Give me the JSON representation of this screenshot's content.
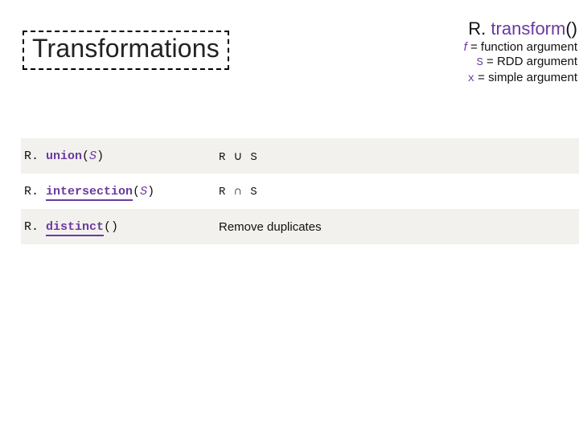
{
  "title": "Transformations",
  "legend": {
    "hdr_prefix": "R. ",
    "hdr_method": "transform",
    "hdr_suffix": "()",
    "rows": [
      {
        "sym": "f",
        "rest": " = function argument"
      },
      {
        "code": "S",
        "rest": " = RDD argument"
      },
      {
        "code": "x",
        "rest": " = simple argument"
      }
    ]
  },
  "rows": [
    {
      "call_prefix": "R. ",
      "method": "union",
      "method_underline": false,
      "call_open": "(",
      "arg": "S",
      "call_close": ")",
      "desc_code_a": "R",
      "desc_sym": "∪",
      "desc_code_b": "S",
      "desc_plain": null
    },
    {
      "call_prefix": "R. ",
      "method": "intersection",
      "method_underline": true,
      "call_open": "(",
      "arg": "S",
      "call_close": ")",
      "desc_code_a": "R",
      "desc_sym": "∩",
      "desc_code_b": "S",
      "desc_plain": null
    },
    {
      "call_prefix": "R. ",
      "method": "distinct",
      "method_underline": true,
      "call_open": "(",
      "arg": "",
      "call_close": ")",
      "desc_code_a": null,
      "desc_sym": null,
      "desc_code_b": null,
      "desc_plain": "Remove duplicates"
    }
  ]
}
